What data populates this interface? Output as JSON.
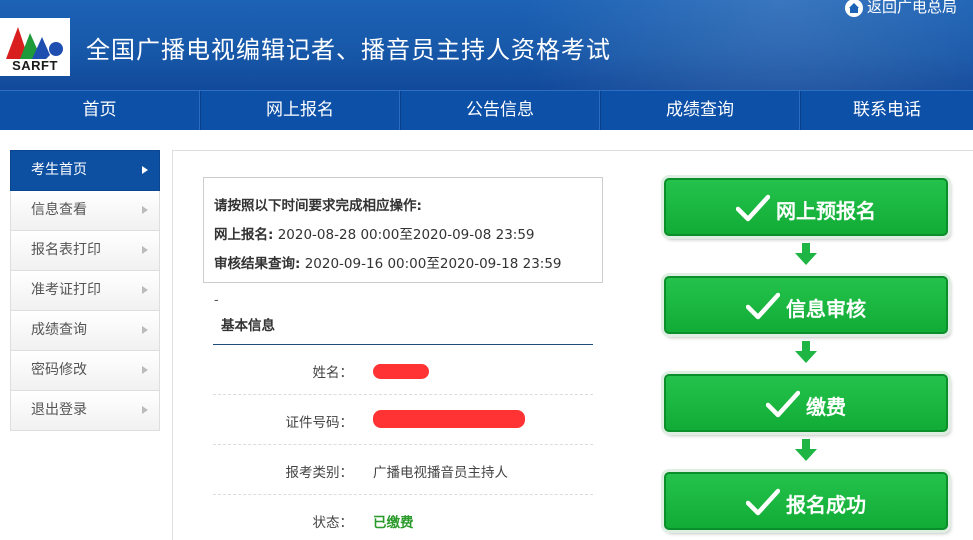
{
  "header": {
    "logo_text": "SARFT",
    "site_title": "全国广播电视编辑记者、播音员主持人资格考试",
    "top_links": "返回广电总局"
  },
  "nav": {
    "items": [
      "首页",
      "网上报名",
      "公告信息",
      "成绩查询",
      "联系电话"
    ]
  },
  "sidebar": {
    "items": [
      {
        "label": "考生首页",
        "active": true
      },
      {
        "label": "信息查看",
        "active": false
      },
      {
        "label": "报名表打印",
        "active": false
      },
      {
        "label": "准考证打印",
        "active": false
      },
      {
        "label": "成绩查询",
        "active": false
      },
      {
        "label": "密码修改",
        "active": false
      },
      {
        "label": "退出登录",
        "active": false
      }
    ]
  },
  "notice": {
    "heading": "请按照以下时间要求完成相应操作:",
    "registration_label": "网上报名:",
    "registration_time": "2020-08-28 00:00至2020-09-08 23:59",
    "review_label": "审核结果查询:",
    "review_time": "2020-09-16 00:00至2020-09-18 23:59"
  },
  "basic_info": {
    "dash": "-",
    "title": "基本信息",
    "name_label": "姓名：",
    "id_label": "证件号码：",
    "category_label": "报考类别：",
    "category_value": "广播电视播音员主持人",
    "status_label": "状态：",
    "status_value": "已缴费"
  },
  "flow": {
    "steps": [
      "网上预报名",
      "信息审核",
      "缴费",
      "报名成功"
    ]
  },
  "colors": {
    "header_blue": "#1c62b5",
    "nav_blue": "#0d50a8",
    "step_green": "#11ac36",
    "status_green": "#2a9a2a",
    "redaction_red": "#ff2222"
  }
}
